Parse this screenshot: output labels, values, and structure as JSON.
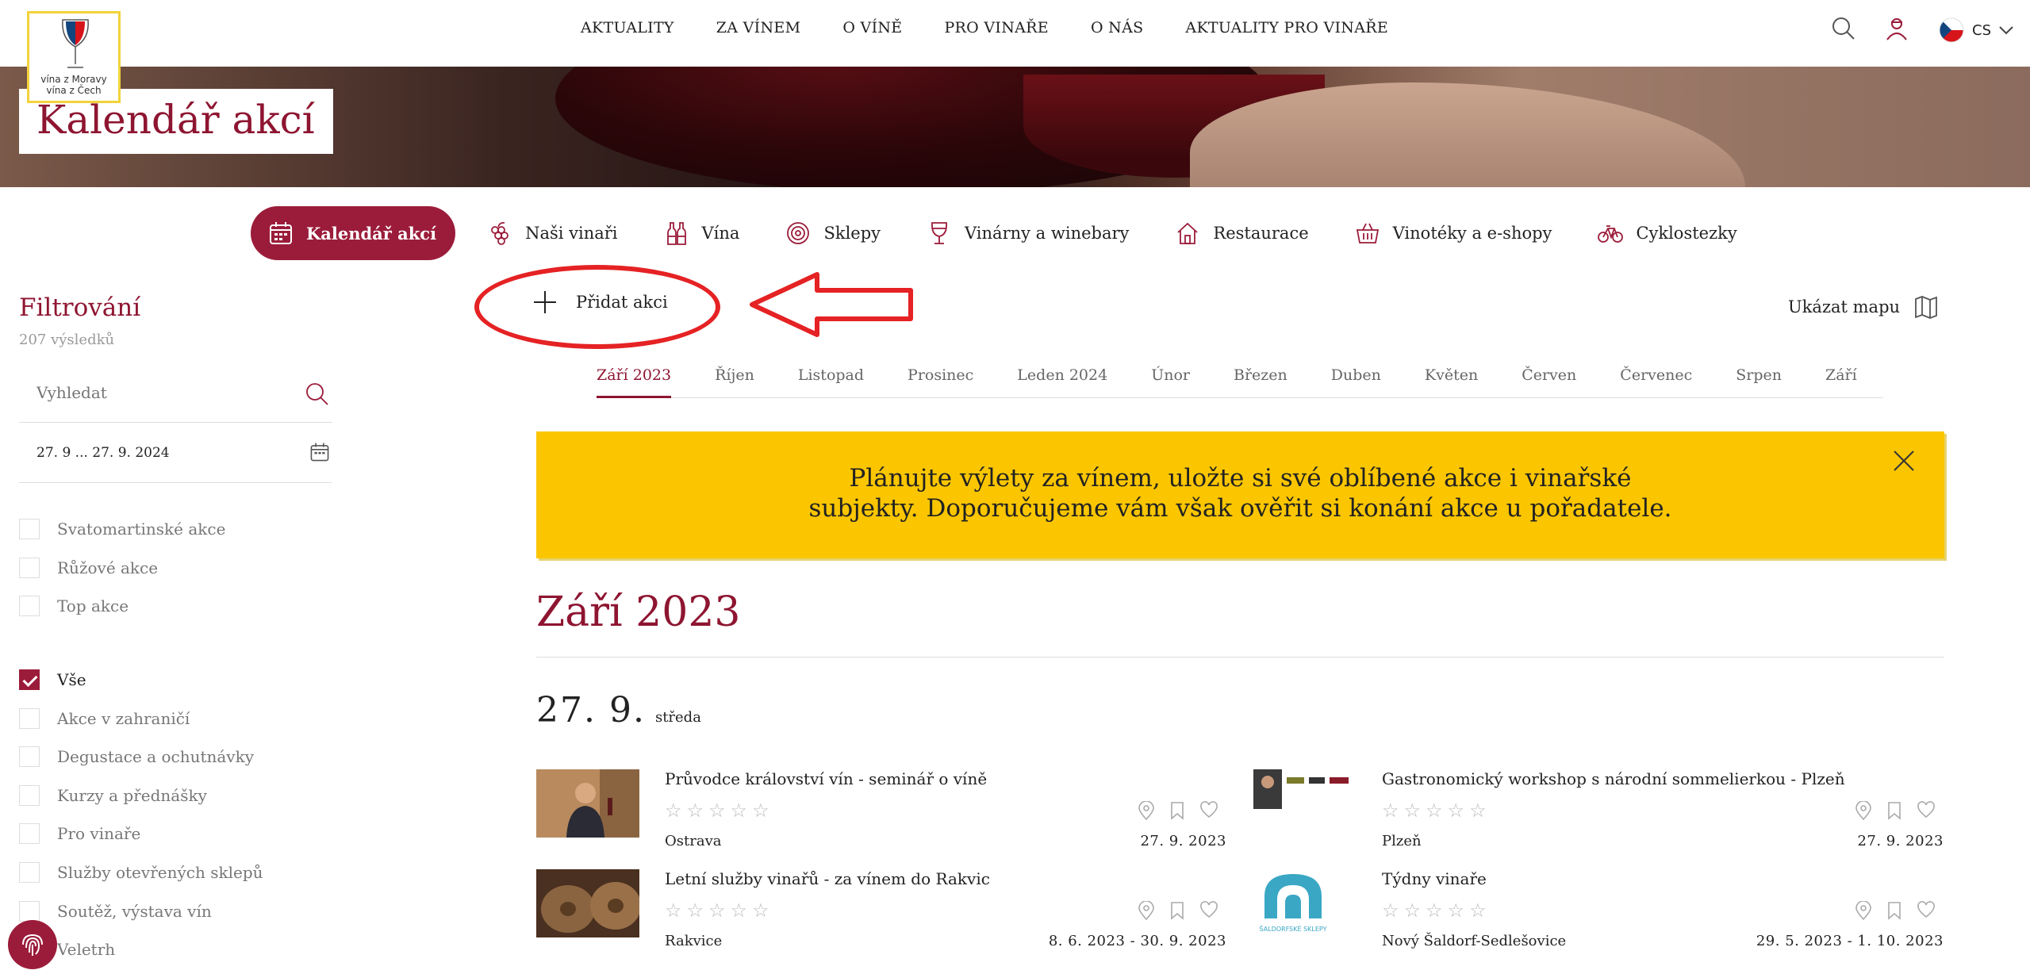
{
  "nav": {
    "logo_text_1": "vína z Moravy",
    "logo_text_2": "vína z Čech",
    "items": [
      "AKTUALITY",
      "ZA VÍNEM",
      "O VÍNĚ",
      "PRO VINAŘE",
      "O NÁS",
      "AKTUALITY PRO VINAŘE"
    ],
    "language": "CS"
  },
  "hero": {
    "title": "Kalendář akcí"
  },
  "categories": [
    "Kalendář akcí",
    "Naši vinaři",
    "Vína",
    "Sklepy",
    "Vinárny a winebary",
    "Restaurace",
    "Vinotéky a e-shopy",
    "Cyklostezky"
  ],
  "sidebar": {
    "title": "Filtrování",
    "count": "207 výsledků",
    "search_placeholder": "Vyhledat",
    "date_range": "27. 9 ... 27. 9. 2024",
    "flags": [
      {
        "label": "Svatomartinské akce",
        "checked": false
      },
      {
        "label": "Růžové akce",
        "checked": false
      },
      {
        "label": "Top akce",
        "checked": false
      }
    ],
    "types": [
      {
        "label": "Vše",
        "checked": true
      },
      {
        "label": "Akce v zahraničí",
        "checked": false
      },
      {
        "label": "Degustace a ochutnávky",
        "checked": false
      },
      {
        "label": "Kurzy a přednášky",
        "checked": false
      },
      {
        "label": "Pro vinaře",
        "checked": false
      },
      {
        "label": "Služby otevřených sklepů",
        "checked": false
      },
      {
        "label": "Soutěž, výstava vín",
        "checked": false
      },
      {
        "label": "Veletrh",
        "checked": false
      }
    ]
  },
  "main": {
    "add_event": "Přidat akci",
    "show_map": "Ukázat mapu",
    "months": [
      "Září 2023",
      "Říjen",
      "Listopad",
      "Prosinec",
      "Leden 2024",
      "Únor",
      "Březen",
      "Duben",
      "Květen",
      "Červen",
      "Červenec",
      "Srpen",
      "Září"
    ],
    "active_month": "Září 2023",
    "notice_line1": "Plánujte výlety za vínem, uložte si své oblíbené akce i vinařské",
    "notice_line2": "subjekty. Doporučujeme vám však ověřit si konání akce u pořadatele.",
    "month_heading": "Září 2023",
    "day_number": "27. 9.",
    "day_weekday": "středa",
    "stars": "☆☆☆☆☆",
    "events": [
      {
        "title": "Průvodce království vín - seminář o víně",
        "place": "Ostrava",
        "date": "27. 9. 2023"
      },
      {
        "title": "Gastronomický workshop s národní sommelierkou - Plzeň",
        "place": "Plzeň",
        "date": "27. 9. 2023"
      },
      {
        "title": "Letní služby vinařů - za vínem do Rakvic",
        "place": "Rakvice",
        "date": "8. 6. 2023 - 30. 9. 2023"
      },
      {
        "title": "Týdny vinaře",
        "place": "Nový Šaldorf-Sedlešovice",
        "date": "29. 5. 2023 - 1. 10. 2023"
      }
    ],
    "saldorf_logo_text": "ŠALDORFSKÉ SKLEPY"
  },
  "colors": {
    "accent": "#9b1c3a",
    "notice": "#fbc600",
    "annotation": "#e52224"
  }
}
